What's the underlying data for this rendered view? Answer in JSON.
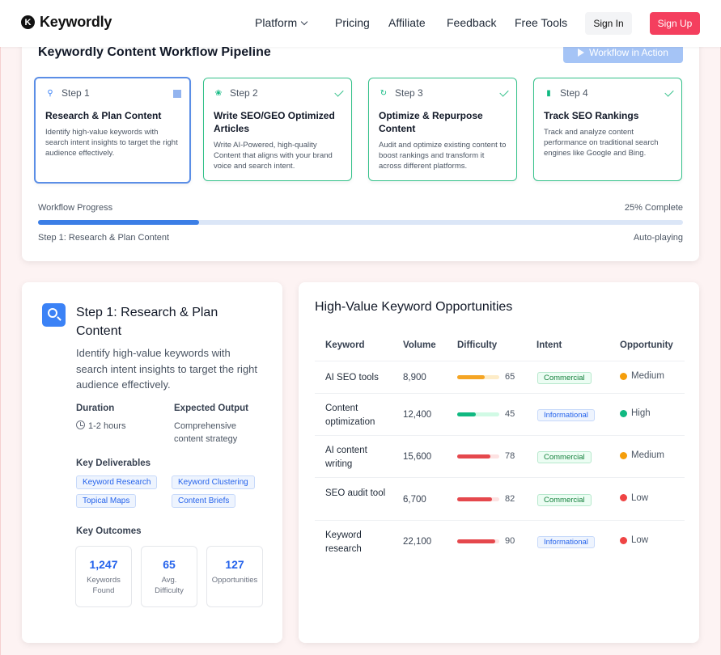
{
  "nav": {
    "brand": "Keywordly",
    "brand_initial": "K",
    "links": [
      "Platform",
      "Pricing",
      "Affiliate",
      "Feedback",
      "Free Tools"
    ],
    "sign_in": "Sign In",
    "sign_up": "Sign Up"
  },
  "pipeline": {
    "title": "Keywordly Content Workflow Pipeline",
    "action_button": "Workflow in Action",
    "steps": [
      {
        "label": "Step 1",
        "title": "Research & Plan Content",
        "desc": "Identify high-value keywords with search intent insights to target the right audience effectively.",
        "icon": "search-icon",
        "state": "active"
      },
      {
        "label": "Step 2",
        "title": "Write SEO/GEO Optimized Articles",
        "desc": "Write AI-Powered, high-quality Content that aligns with your brand voice and search intent.",
        "icon": "leaf-icon",
        "state": "done"
      },
      {
        "label": "Step 3",
        "title": "Optimize & Repurpose Content",
        "desc": "Audit and optimize existing content to boost rankings and transform it across different platforms.",
        "icon": "refresh-icon",
        "state": "done"
      },
      {
        "label": "Step 4",
        "title": "Track SEO Rankings",
        "desc": "Track and analyze content performance on traditional search engines like Google and Bing.",
        "icon": "bar-chart-icon",
        "state": "done"
      }
    ],
    "progress_label": "Workflow Progress",
    "progress_text": "25% Complete",
    "progress_value": 0.25,
    "current_step": "Step 1: Research & Plan Content",
    "mode": "Auto-playing"
  },
  "detail": {
    "title": "Step 1: Research & Plan Content",
    "desc": "Identify high-value keywords with search intent insights to target the right audience effectively.",
    "duration_label": "Duration",
    "duration_value": "1-2 hours",
    "output_label": "Expected Output",
    "output_value": "Comprehensive content strategy",
    "deliverables_label": "Key Deliverables",
    "deliverables": [
      "Keyword Research",
      "Keyword Clustering",
      "Topical Maps",
      "Content Briefs"
    ],
    "outcomes_label": "Key Outcomes",
    "outcomes": [
      {
        "num": "1,247",
        "label": "Keywords Found"
      },
      {
        "num": "65",
        "label": "Avg. Difficulty"
      },
      {
        "num": "127",
        "label": "Opportunities"
      }
    ]
  },
  "keywords": {
    "title": "High-Value Keyword Opportunities",
    "headers": [
      "Keyword",
      "Volume",
      "Difficulty",
      "Intent",
      "Opportunity"
    ],
    "rows": [
      {
        "keyword": "AI SEO tools",
        "volume": "8,900",
        "difficulty": 65,
        "intent": "Commercial",
        "opportunity": "Medium"
      },
      {
        "keyword": "Content optimization",
        "volume": "12,400",
        "difficulty": 45,
        "intent": "Informational",
        "opportunity": "High"
      },
      {
        "keyword": "AI content writing",
        "volume": "15,600",
        "difficulty": 78,
        "intent": "Commercial",
        "opportunity": "Medium"
      },
      {
        "keyword": "SEO audit tool",
        "volume": "6,700",
        "difficulty": 82,
        "intent": "Commercial",
        "opportunity": "Low"
      },
      {
        "keyword": "Keyword research",
        "volume": "22,100",
        "difficulty": 90,
        "intent": "Informational",
        "opportunity": "Low"
      }
    ],
    "colors": {
      "medium": "#f59e0b",
      "high": "#10b981",
      "low": "#ef4444"
    }
  }
}
